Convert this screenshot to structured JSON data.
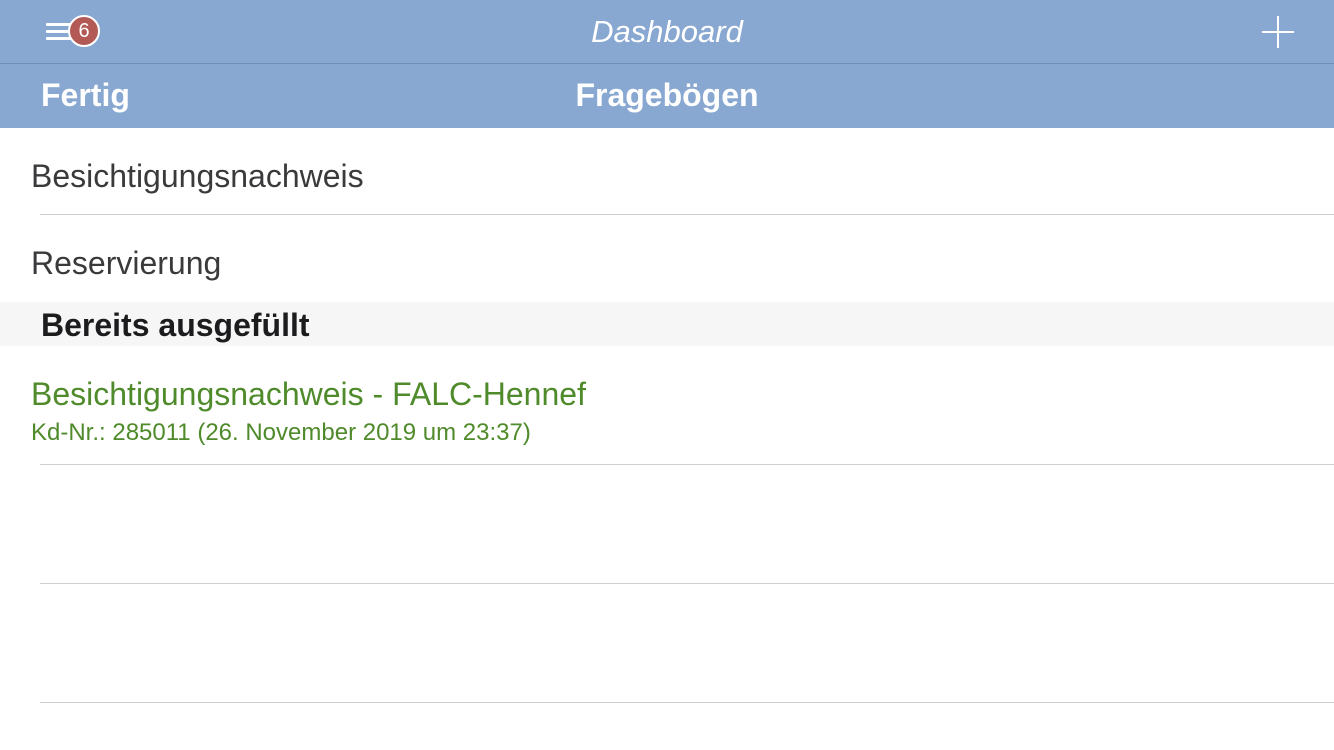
{
  "topbar": {
    "title": "Dashboard",
    "menu_badge": "6"
  },
  "navbar": {
    "done_label": "Fertig",
    "title": "Fragebögen"
  },
  "templates": [
    {
      "label": "Besichtigungsnachweis"
    },
    {
      "label": "Reservierung"
    }
  ],
  "section": {
    "label": "Bereits ausgefüllt"
  },
  "filled": [
    {
      "title": "Besichtigungsnachweis - FALC-Hennef",
      "subtitle": "Kd-Nr.: 285011 (26. November 2019 um 23:37)"
    }
  ],
  "colors": {
    "bar": "#88a8d1",
    "badge": "#b35a57",
    "filled_text": "#4f8a2b"
  },
  "icons": {
    "menu": "hamburger-icon",
    "add": "plus-icon"
  }
}
